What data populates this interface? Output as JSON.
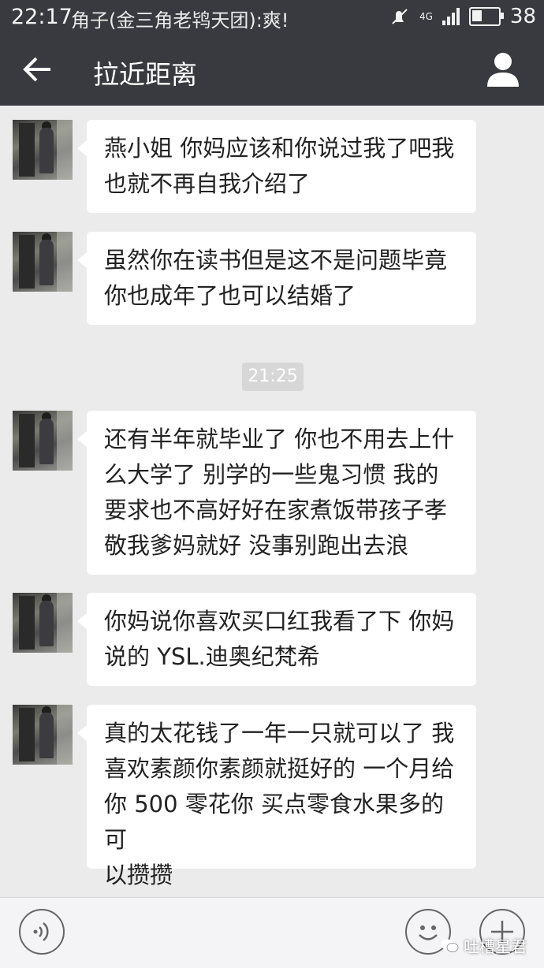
{
  "status_bar": {
    "time": "22:17",
    "notification": "角子(金三角老鸨天团):爽!",
    "network": "4G",
    "battery": "38"
  },
  "header": {
    "title": "拉近距离"
  },
  "messages": [
    {
      "text": "燕小姐 你妈应该和你说过我了吧我\n也就不再自我介绍了"
    },
    {
      "text": "虽然你在读书但是这不是问题毕竟\n你也成年了也可以结婚了"
    },
    {
      "text": "还有半年就毕业了 你也不用去上什\n么大学了 别学的一些鬼习惯 我的\n要求也不高好好在家煮饭带孩子孝\n敬我爹妈就好 没事别跑出去浪"
    },
    {
      "text": "你妈说你喜欢买口红我看了下 你妈\n说的 YSL.迪奥纪梵希"
    },
    {
      "text": "真的太花钱了一年一只就可以了 我\n喜欢素颜你素颜就挺好的 一个月给\n你 500 零花你 买点零食水果多的可\n以攒攒"
    }
  ],
  "timestamp": "21:25",
  "watermark": "吐槽星君",
  "colors": {
    "header_bg": "#393a3f",
    "chat_bg": "#ebebeb",
    "bubble_bg": "#ffffff",
    "timestamp_bg": "#d7d7d7"
  }
}
